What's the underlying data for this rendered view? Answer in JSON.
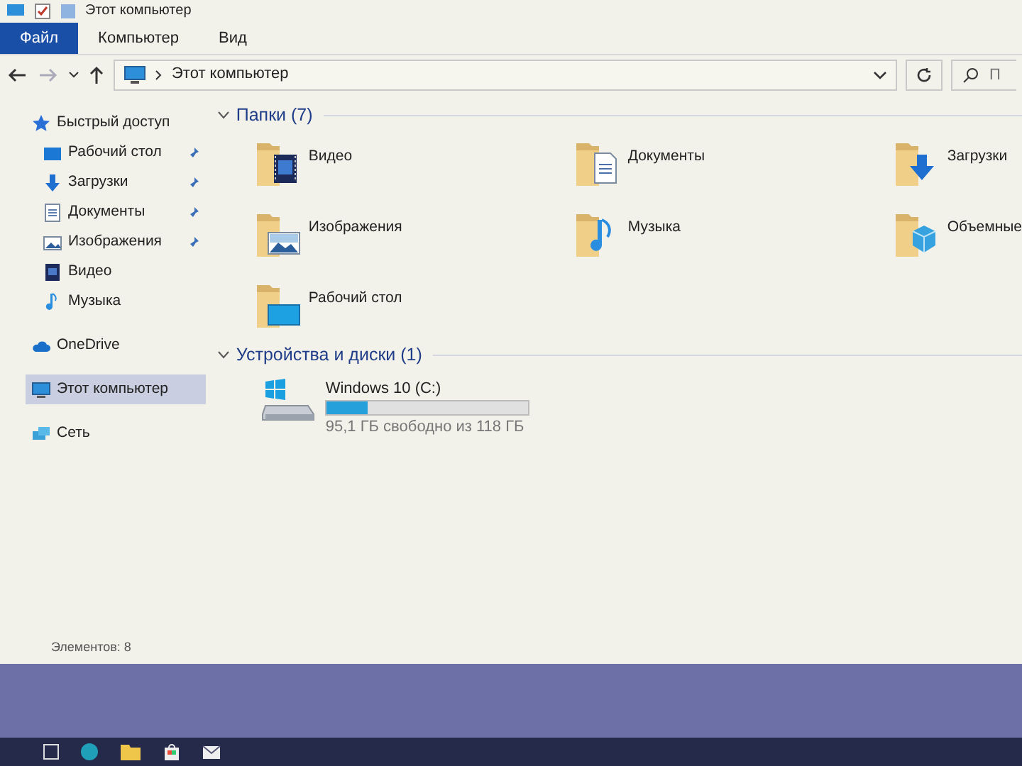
{
  "window": {
    "title": "Этот компьютер"
  },
  "ribbon_tabs": [
    {
      "label": "Файл",
      "selected": true
    },
    {
      "label": "Компьютер",
      "selected": false
    },
    {
      "label": "Вид",
      "selected": false
    }
  ],
  "address": {
    "path": "Этот компьютер"
  },
  "search": {
    "placeholder": "П"
  },
  "sidebar": {
    "items": [
      {
        "label": "Быстрый доступ",
        "kind": "star",
        "selected": false,
        "children": [
          {
            "label": "Рабочий стол",
            "kind": "desktop",
            "pinned": true,
            "selected": false
          },
          {
            "label": "Загрузки",
            "kind": "download",
            "pinned": true,
            "selected": false
          },
          {
            "label": "Документы",
            "kind": "document",
            "pinned": true,
            "selected": false
          },
          {
            "label": "Изображения",
            "kind": "picture",
            "pinned": true,
            "selected": false
          },
          {
            "label": "Видео",
            "kind": "video",
            "pinned": false,
            "selected": false
          },
          {
            "label": "Музыка",
            "kind": "music",
            "pinned": false,
            "selected": false
          }
        ]
      },
      {
        "label": "OneDrive",
        "kind": "cloud",
        "selected": false
      },
      {
        "label": "Этот компьютер",
        "kind": "computer",
        "selected": true
      },
      {
        "label": "Сеть",
        "kind": "network",
        "selected": false
      }
    ]
  },
  "folders": {
    "title": "Папки (7)",
    "items": [
      {
        "label": "Видео",
        "kind": "video"
      },
      {
        "label": "Документы",
        "kind": "document"
      },
      {
        "label": "Загрузки",
        "kind": "download"
      },
      {
        "label": "Изображения",
        "kind": "picture"
      },
      {
        "label": "Музыка",
        "kind": "music"
      },
      {
        "label": "Объемные",
        "kind": "cube"
      },
      {
        "label": "Рабочий стол",
        "kind": "desktop"
      }
    ]
  },
  "devices": {
    "title": "Устройства и диски (1)",
    "drives": [
      {
        "name": "Windows 10 (C:)",
        "level": 0.2,
        "reading": "95,1 ГБ свободно из 118 ГБ"
      }
    ]
  },
  "status_bar": {
    "text": "Элементов: 8"
  }
}
